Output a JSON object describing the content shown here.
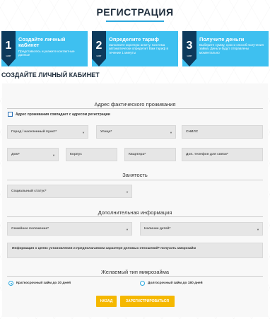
{
  "page_title": "РЕГИСТРАЦИЯ",
  "steps": [
    {
      "number": "1",
      "word": "шаг",
      "title": "Создайте личный кабинет",
      "desc": "Представьтесь и укажите контактные данные"
    },
    {
      "number": "2",
      "word": "шаг",
      "title": "Определите тариф",
      "desc": "Заполните короткую анкету. Система автоматически определит Вам тариф в течение 1 минуты"
    },
    {
      "number": "3",
      "word": "шаг",
      "title": "Получите деньги",
      "desc": "Выберите сумму, срок и способ получения займа. Деньги будут отправлены моментально"
    }
  ],
  "cabinet_title": "СОЗДАЙТЕ ЛИЧНЫЙ КАБИНЕТ",
  "address": {
    "title": "Адрес фактического проживания",
    "checkbox_label": "Адрес проживания совпадает с адресом регистрации",
    "city": "Город / населенный пункт*",
    "street": "Улица*",
    "snils": "СНИЛС",
    "house": "Дом*",
    "building": "Корпус",
    "apartment": "Квартира*",
    "extra_phone": "Доп. телефон для связи*"
  },
  "employment": {
    "title": "Занятость",
    "social_status": "Социальный статус*"
  },
  "additional": {
    "title": "Дополнительная информация",
    "marital": "Семейное положение*",
    "children": "Наличие детей*",
    "info_text": "Информация о целях установления и предполагаемом характере деловых отношений* получить микрозайм"
  },
  "loan": {
    "title": "Желаемый тип микрозайма",
    "short_term": "Краткосрочный займ до 30 дней",
    "long_term": "Долгосрочный займ до 180 дней"
  },
  "buttons": {
    "back": "НАЗАД",
    "register": "ЗАРЕГИСТРИРОВАТЬСЯ"
  },
  "colors": {
    "accent": "#3ec0f0",
    "step_number_bg": "#0d3a5c",
    "button": "#f5b800"
  }
}
